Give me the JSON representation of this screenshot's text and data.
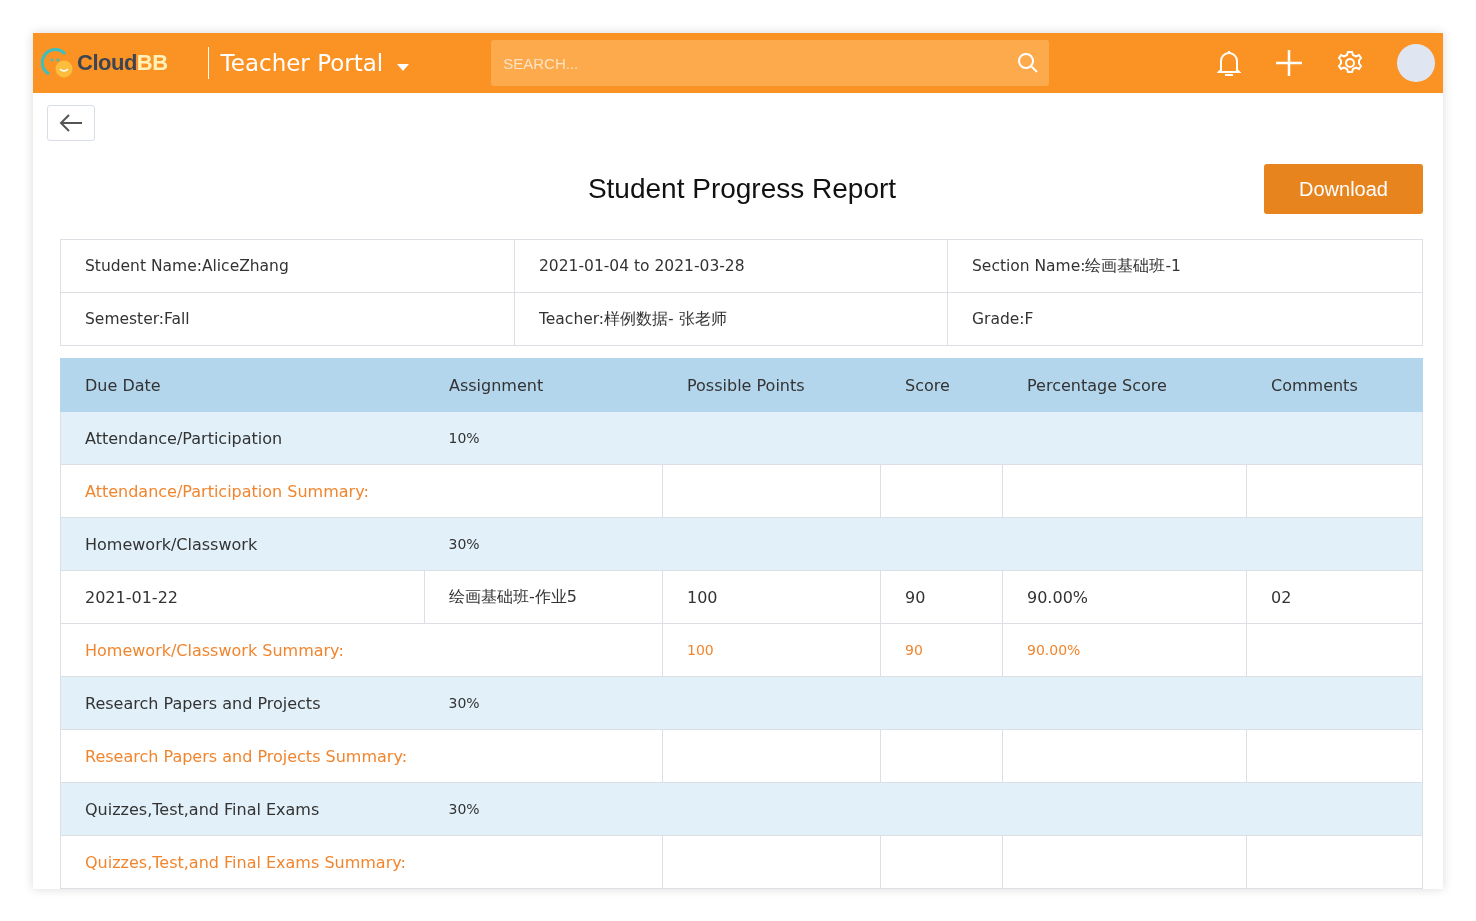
{
  "header": {
    "logo": [
      "Cloud",
      "BB"
    ],
    "portal": "Teacher Portal",
    "search": {
      "placeholder": "SEARCH..."
    }
  },
  "title": "Student Progress Report",
  "download": "Download",
  "info": [
    [
      "Student Name:AliceZhang",
      "2021-01-04 to 2021-03-28",
      "Section Name:绘画基础班-1"
    ],
    [
      "Semester:Fall",
      "Teacher:样例数据- 张老师",
      "Grade:F"
    ]
  ],
  "table": {
    "columns": [
      "Due Date",
      "Assignment",
      "Possible Points",
      "Score",
      "Percentage Score",
      "Comments"
    ],
    "rows": [
      {
        "kind": "category",
        "name": "Attendance/Participation",
        "weight": "10%"
      },
      {
        "kind": "summary",
        "label": "Attendance/Participation Summary:",
        "cells": []
      },
      {
        "kind": "category",
        "name": "Homework/Classwork",
        "weight": "30%"
      },
      {
        "kind": "item",
        "cells": [
          "2021-01-22",
          "绘画基础班-作业5",
          "100",
          "90",
          "90.00%",
          "02"
        ]
      },
      {
        "kind": "summary",
        "label": "Homework/Classwork Summary:",
        "cells": [
          "100",
          "90",
          "90.00%"
        ]
      },
      {
        "kind": "category",
        "name": "Research Papers and Projects",
        "weight": "30%"
      },
      {
        "kind": "summary",
        "label": "Research Papers and Projects Summary:",
        "cells": []
      },
      {
        "kind": "category",
        "name": "Quizzes,Test,and Final Exams",
        "weight": "30%"
      },
      {
        "kind": "summary",
        "label": "Quizzes,Test,and Final Exams Summary:",
        "cells": []
      }
    ]
  }
}
